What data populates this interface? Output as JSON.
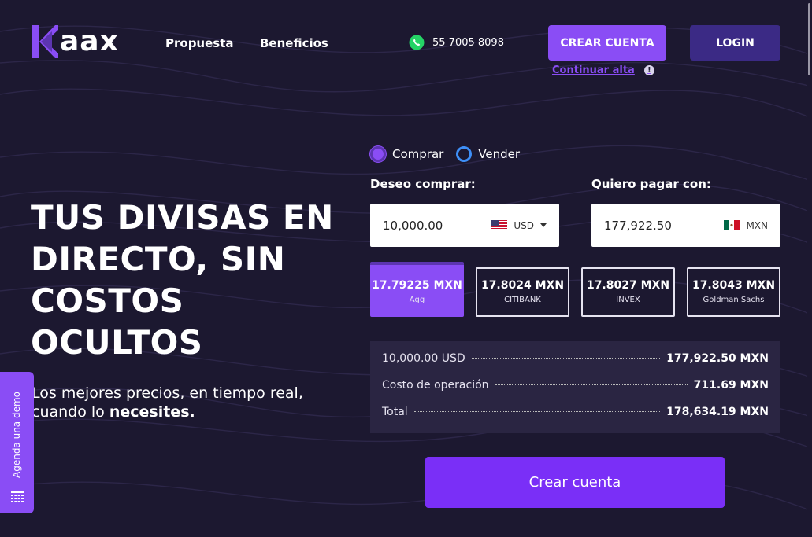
{
  "header": {
    "logo_text": "aax",
    "nav": [
      "Propuesta",
      "Beneficios"
    ],
    "phone": "55 7005 8098",
    "create_account": "CREAR CUENTA",
    "login": "LOGIN",
    "continue_signup": "Continuar alta",
    "info_icon": "!"
  },
  "hero": {
    "title": "TUS DIVISAS EN DIRECTO, SIN COSTOS OCULTOS",
    "subtitle_plain": "Los mejores precios, en tiempo real, cuando lo ",
    "subtitle_bold": "necesites."
  },
  "side_tab": {
    "label": "Agenda una demo",
    "icon": "calendar-icon"
  },
  "converter": {
    "mode_options": [
      {
        "label": "Comprar",
        "selected": true
      },
      {
        "label": "Vender",
        "selected": false
      }
    ],
    "buy_label": "Deseo comprar:",
    "buy_value": "10,000.00",
    "buy_currency": "USD",
    "pay_label": "Quiero pagar con:",
    "pay_value": "177,922.50",
    "pay_currency": "MXN",
    "rates": [
      {
        "value": "17.79225 MXN",
        "provider": "Agg",
        "active": true
      },
      {
        "value": "17.8024 MXN",
        "provider": "CITIBANK",
        "active": false
      },
      {
        "value": "17.8027 MXN",
        "provider": "INVEX",
        "active": false
      },
      {
        "value": "17.8043 MXN",
        "provider": "Goldman Sachs",
        "active": false
      }
    ],
    "summary": [
      {
        "label": "10,000.00 USD",
        "value": "177,922.50 MXN"
      },
      {
        "label": "Costo de operación",
        "value": "711.69 MXN"
      },
      {
        "label": "Total",
        "value": "178,634.19 MXN"
      }
    ],
    "cta": "Crear cuenta"
  },
  "colors": {
    "background": "#1c1830",
    "accent": "#8a4df5",
    "accent_dark": "#3b2a85",
    "cta": "#7a2ff7",
    "radio_off": "#3e8ff7"
  }
}
